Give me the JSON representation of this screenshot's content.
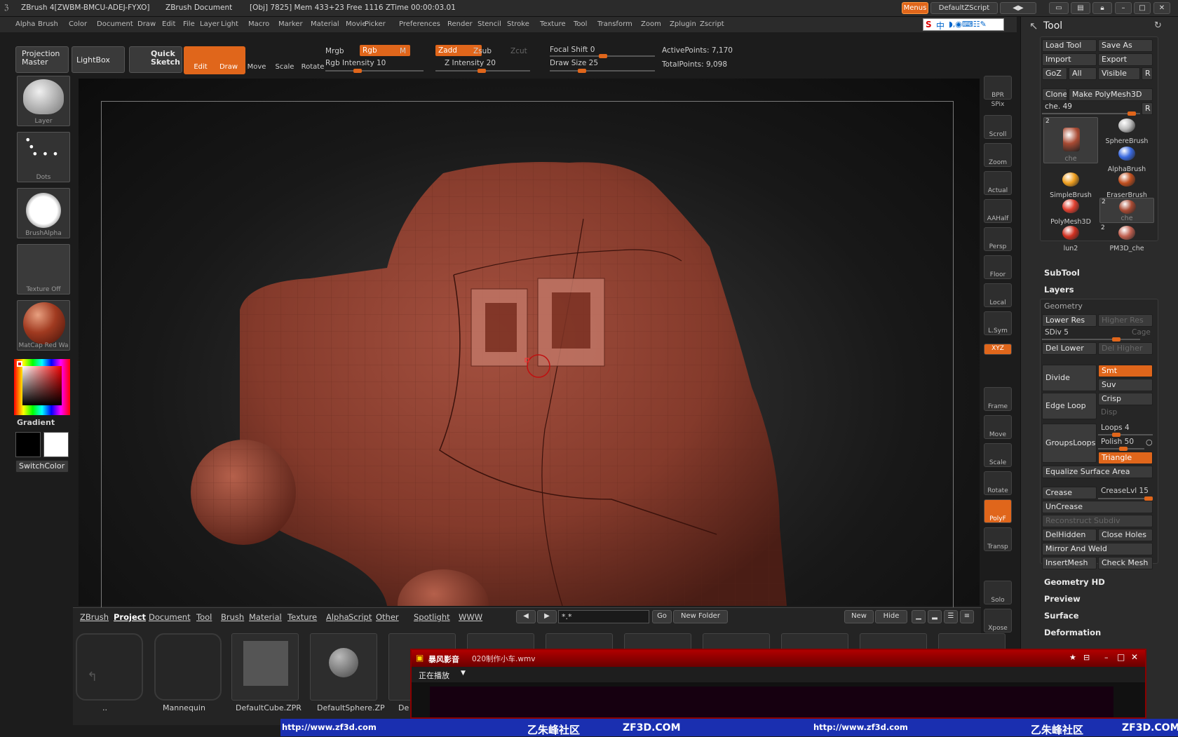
{
  "window": {
    "title": "ZBrush 4[ZWBM-BMCU-ADEJ-FYXO]",
    "document": "ZBrush Document",
    "stats": "[Obj] 7825]  Mem 433+23  Free 1116  ZTime 00:00:03.01",
    "menus_btn": "Menus",
    "script_btn": "DefaultZScript"
  },
  "menubar": [
    "Alpha",
    "Brush",
    "Color",
    "Document",
    "Draw",
    "Edit",
    "File",
    "Layer",
    "Light",
    "Macro",
    "Marker",
    "Material",
    "Movie",
    "Picker",
    "Preferences",
    "Render",
    "Stencil",
    "Stroke",
    "Texture",
    "Tool",
    "Transform",
    "Zoom",
    "Zplugin",
    "Zscript"
  ],
  "toolbar": {
    "projection_master": "Projection Master",
    "lightbox": "LightBox",
    "quick_sketch": "Quick Sketch",
    "edit": "Edit",
    "draw": "Draw",
    "move": "Move",
    "scale": "Scale",
    "rotate": "Rotate",
    "mrgb": "Mrgb",
    "rgb": "Rgb",
    "m": "M",
    "zadd": "Zadd",
    "zsub": "Zsub",
    "zcut": "Zcut",
    "rgb_intensity": "Rgb  Intensity 10",
    "z_intensity": "Z  Intensity 20",
    "focal_shift": "Focal  Shift 0",
    "draw_size": "Draw  Size 25",
    "active_points": "ActivePoints: 7,170",
    "total_points": "TotalPoints: 9,098"
  },
  "left_shelf": {
    "layer": "Layer",
    "dots": "Dots",
    "brush_alpha": "BrushAlpha",
    "texture_off": "Texture Off",
    "matcap": "MatCap Red Wa",
    "gradient": "Gradient",
    "switch_color": "SwitchColor"
  },
  "right_shelf": [
    "BPR",
    "SPix",
    "Scroll",
    "Zoom",
    "Actual",
    "AAHalf",
    "Persp",
    "Floor",
    "Local",
    "L.Sym",
    "XYZ",
    "Frame",
    "Move",
    "Scale",
    "Rotate",
    "PolyF",
    "Transp",
    "Solo",
    "Xpose"
  ],
  "tool_panel": {
    "title": "Tool",
    "load_tool": "Load Tool",
    "save_as": "Save As",
    "import": "Import",
    "export": "Export",
    "goz": "GoZ",
    "all": "All",
    "visible": "Visible",
    "r": "R",
    "clone": "Clone",
    "make_polymesh": "Make PolyMesh3D",
    "che_slider": "che. 49",
    "tools": [
      {
        "name": "che",
        "count": "2"
      },
      {
        "name": "SphereBrush",
        "count": ""
      },
      {
        "name": "AlphaBrush",
        "count": ""
      },
      {
        "name": "SimpleBrush",
        "count": ""
      },
      {
        "name": "EraserBrush",
        "count": ""
      },
      {
        "name": "PolyMesh3D",
        "count": ""
      },
      {
        "name": "che",
        "count": "2"
      },
      {
        "name": "lun2",
        "count": ""
      },
      {
        "name": "PM3D_che",
        "count": "2"
      }
    ],
    "subtool": "SubTool",
    "layers": "Layers",
    "geometry": "Geometry",
    "lower_res": "Lower Res",
    "higher_res": "Higher Res",
    "sdiv": "SDiv 5",
    "cage": "Cage",
    "del_lower": "Del Lower",
    "del_higher": "Del Higher",
    "divide": "Divide",
    "smt": "Smt",
    "suv": "Suv",
    "edge_loop": "Edge Loop",
    "crisp": "Crisp",
    "disp": "Disp",
    "groups_loops": "GroupsLoops",
    "loops": "Loops 4",
    "polish": "Polish 50",
    "triangle": "Triangle",
    "equalize": "Equalize Surface Area",
    "crease": "Crease",
    "crease_lvl": "CreaseLvl 15",
    "uncrease": "UnCrease",
    "reconstruct": "Reconstruct Subdiv",
    "del_hidden": "DelHidden",
    "close_holes": "Close Holes",
    "mirror_weld": "Mirror And Weld",
    "insert_mesh": "InsertMesh",
    "check_mesh": "Check Mesh",
    "geometry_hd": "Geometry HD",
    "preview": "Preview",
    "surface": "Surface",
    "deformation": "Deformation"
  },
  "lightbox": {
    "tabs": [
      "ZBrush",
      "Project",
      "Document",
      "Tool",
      "Brush",
      "Material",
      "Texture",
      "Alpha",
      "Script",
      "Other",
      "Spotlight",
      "WWW"
    ],
    "search": "*.*",
    "go": "Go",
    "new_folder": "New Folder",
    "new": "New",
    "hide": "Hide",
    "items": [
      "..",
      "Mannequin",
      "DefaultCube.ZPR",
      "DefaultSphere.ZP",
      "De"
    ]
  },
  "player": {
    "app": "暴风影音",
    "file": "020制作小车.wmv",
    "status": "正在播放"
  },
  "watermark": {
    "url1": "http://www.zf3d.com",
    "brand1": "乙朱峰社区",
    "site1": "ZF3D.COM",
    "url2": "http://www.zf3d.com",
    "brand2": "乙朱峰社区",
    "site2": "ZF3D.COM"
  },
  "colors": {
    "accent": "#e0661b",
    "model": "#8a3a2c",
    "panel": "#2b2b2b"
  }
}
